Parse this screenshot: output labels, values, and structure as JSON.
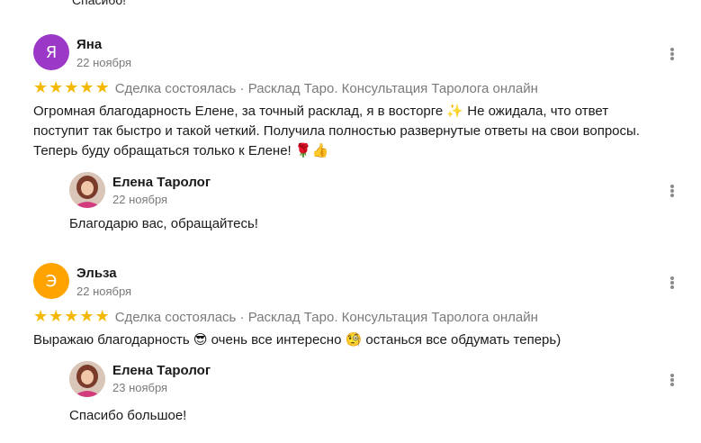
{
  "top_cut_text": "Спасибо!",
  "reviews": [
    {
      "avatar_letter": "Я",
      "avatar_color": "#9b38c8",
      "author": "Яна",
      "date": "22 ноября",
      "deal_text": "Сделка состоялась · Расклад Таро. Консультация Таролога онлайн",
      "rating": 5,
      "text_lines": [
        "Огромная благодарность Елене, за точный расклад, я в восторге ✨ Не ожидала, что ответ",
        "поступит так быстро и такой четкий. Получила полностью развернутые ответы на свои вопросы.",
        "Теперь буду обращаться только к Елене! 🌹👍"
      ],
      "reply": {
        "author": "Елена Таролог",
        "date": "22 ноября",
        "text": "Благодарю вас, обращайтесь!"
      }
    },
    {
      "avatar_letter": "Э",
      "avatar_color": "#ffa300",
      "author": "Эльза",
      "date": "22 ноября",
      "deal_text": "Сделка состоялась · Расклад Таро. Консультация Таролога онлайн",
      "rating": 5,
      "text_lines": [
        "Выражаю благодарность 😎 очень все интересно 🧐 останься все обдумать теперь)"
      ],
      "reply": {
        "author": "Елена Таролог",
        "date": "23 ноября",
        "text": "Спасибо большое!"
      }
    }
  ],
  "star_glyph": "★",
  "icons": {
    "menu": "more-vertical-icon",
    "star": "star-icon"
  }
}
